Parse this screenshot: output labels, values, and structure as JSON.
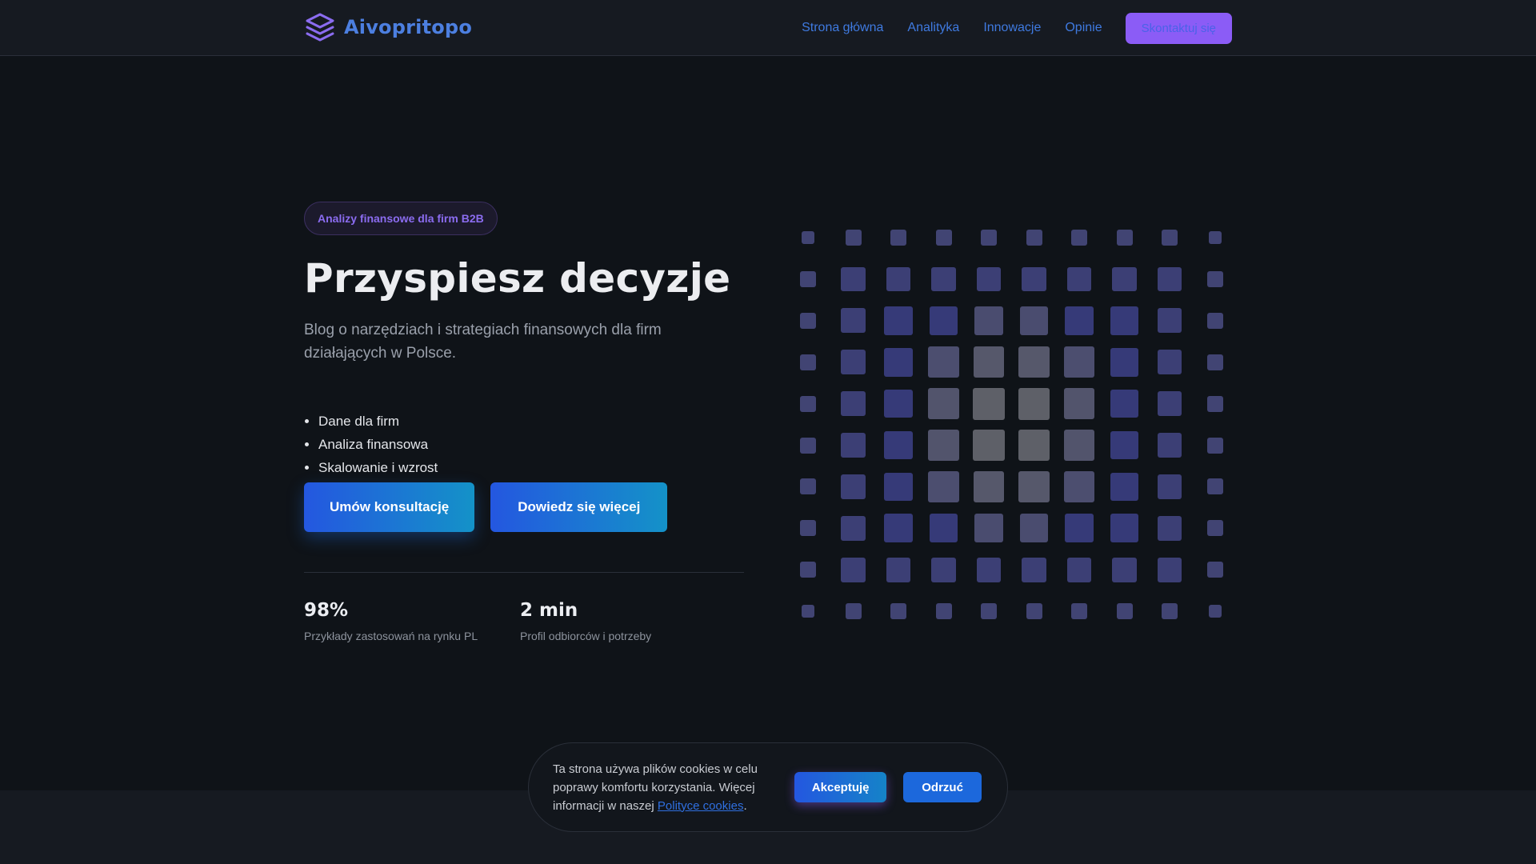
{
  "brand": {
    "name": "Aivopritopo",
    "logo_icon": "layers-icon",
    "color": "#4c7fe0"
  },
  "nav": {
    "links": [
      "Strona główna",
      "Analityka",
      "Innowacje",
      "Opinie"
    ],
    "cta": "Skontaktuj się"
  },
  "hero": {
    "pill": "Analizy finansowe dla firm B2B",
    "title": "Przyspiesz decyzje",
    "subtitle": "Blog o narzędziach i strategiach finansowych dla firm działających w Polsce.",
    "features": [
      "Dane dla firm",
      "Analiza finansowa",
      "Skalowanie i wzrost"
    ],
    "primary_button": "Umów konsultację",
    "secondary_button": "Dowiedz się więcej"
  },
  "stats": [
    {
      "value": "98%",
      "label": "Przykłady zastosowań na rynku PL"
    },
    {
      "value": "2 min",
      "label": "Profil odbiorców i potrzeby"
    }
  ],
  "cookie": {
    "text_before": "Ta strona używa plików cookies w celu poprawy komfortu korzystania. Więcej informacji w naszej ",
    "link": "Polityce cookies",
    "text_after": ".",
    "accept": "Akceptuję",
    "reject": "Odrzuć"
  },
  "colors": {
    "background": "#0f1318",
    "header": "#161a21",
    "accent_purple": "#8b5cf6",
    "accent_blue": "#2457e0",
    "grid_blue": "#363a78",
    "grid_gray": "#5c5e68"
  }
}
